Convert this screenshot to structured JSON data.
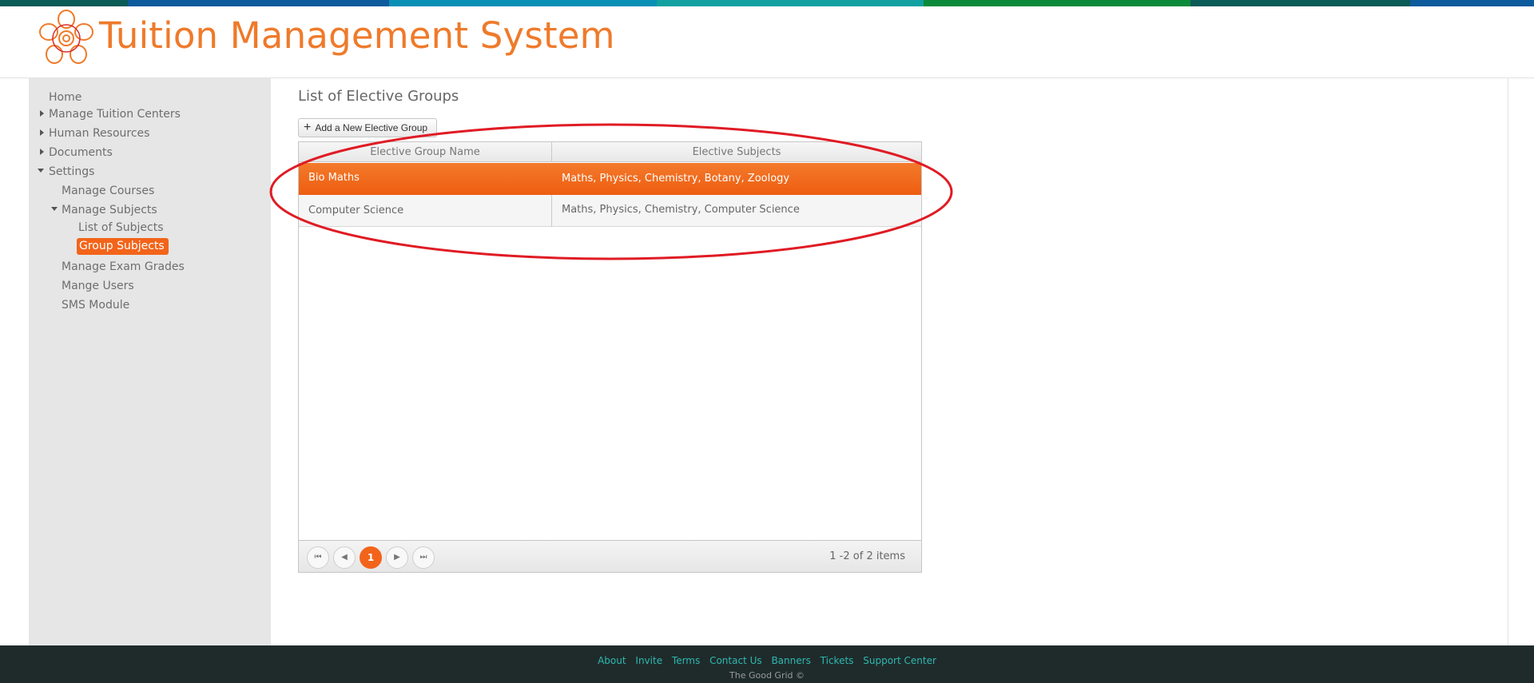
{
  "colors": {
    "accent": "#f2641a",
    "title_orange": "#ef7a2a",
    "footer_bg": "#1f2b2b",
    "footer_link": "#2fb8b0",
    "stripe": [
      "#0a5a56",
      "#0d5a9c",
      "#0a7db0",
      "#12a0a0",
      "#0a8a3a",
      "#0a5a56",
      "#0d5a9c"
    ]
  },
  "header": {
    "title": "Tuition Management System",
    "logo_icon": "flower-logo-icon"
  },
  "sidebar": {
    "items": [
      {
        "label": "Home"
      },
      {
        "label": "Manage Tuition Centers"
      },
      {
        "label": "Human Resources"
      },
      {
        "label": "Documents"
      },
      {
        "label": "Settings"
      },
      {
        "label": "Manage Courses"
      },
      {
        "label": "Manage Subjects"
      },
      {
        "label": "List of Subjects"
      },
      {
        "label": "Group Subjects"
      },
      {
        "label": "Manage Exam Grades"
      },
      {
        "label": "Mange Users"
      },
      {
        "label": "SMS Module"
      }
    ]
  },
  "main": {
    "title": "List of Elective Groups",
    "add_button": "Add a New Elective Group",
    "columns": [
      "Elective Group Name",
      "Elective Subjects"
    ],
    "rows": [
      {
        "name": "Bio Maths",
        "subjects": "Maths, Physics, Chemistry, Botany, Zoology"
      },
      {
        "name": "Computer Science",
        "subjects": "Maths, Physics, Chemistry, Computer Science"
      }
    ],
    "pager": {
      "current_page": "1",
      "info": "1 -2 of 2 items"
    }
  },
  "footer": {
    "links": [
      "About",
      "Invite",
      "Terms",
      "Contact Us",
      "Banners",
      "Tickets",
      "Support Center"
    ],
    "copyright": "The Good Grid ©"
  }
}
